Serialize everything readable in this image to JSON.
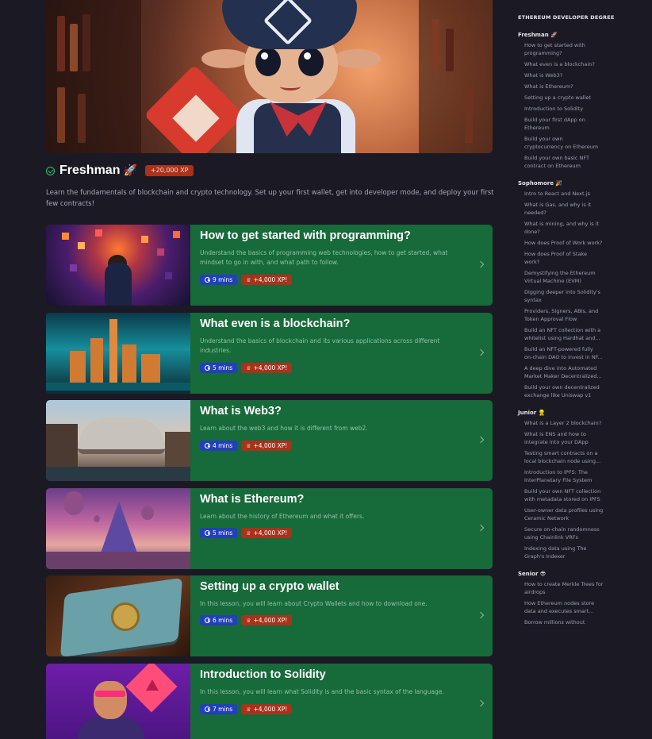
{
  "hero": {
    "alt": "Cartoon elf character in a pirate hat"
  },
  "header": {
    "title": "Freshman",
    "title_emoji": "🚀",
    "xp_badge": "+20,000 XP",
    "intro": "Learn the fundamentals of blockchain and crypto technology. Set up your first wallet, get into developer mode, and deploy your first few contracts!"
  },
  "lessons": [
    {
      "title": "How to get started with programming?",
      "description": "Understand the basics of programming web technologies, how to get started, what mindset to go in with, and what path to follow.",
      "time": "9 mins",
      "xp": "+4,000 XP!"
    },
    {
      "title": "What even is a blockchain?",
      "description": "Understand the basics of blockchain and its various applications across different industries.",
      "time": "5 mins",
      "xp": "+4,000 XP!"
    },
    {
      "title": "What is Web3?",
      "description": "Learn about the web3 and how it is different from web2.",
      "time": "4 mins",
      "xp": "+4,000 XP!"
    },
    {
      "title": "What is Ethereum?",
      "description": "Learn about the history of Ethereum and what it offers.",
      "time": "5 mins",
      "xp": "+4,000 XP!"
    },
    {
      "title": "Setting up a crypto wallet",
      "description": "In this lesson, you will learn about Crypto Wallets and how to download one.",
      "time": "6 mins",
      "xp": "+4,000 XP!"
    },
    {
      "title": "Introduction to Solidity",
      "description": "In this lesson, you will learn what Solidity is and the basic syntax of the language.",
      "time": "7 mins",
      "xp": "+4,000 XP!"
    }
  ],
  "sidebar": {
    "heading": "ETHEREUM DEVELOPER DEGREE",
    "sections": [
      {
        "label": "Freshman 🚀",
        "items": [
          [
            "How to get started with",
            "programming?"
          ],
          [
            "What even is a blockchain?"
          ],
          [
            "What is Web3?"
          ],
          [
            "What is Ethereum?"
          ],
          [
            "Setting up a crypto wallet"
          ],
          [
            "Introduction to Solidity"
          ],
          [
            "Build your first dApp on",
            "Ethereum"
          ],
          [
            "Build your own",
            "cryptocurrency on Ethereum"
          ],
          [
            "Build your own basic NFT",
            "contract on Ethereum"
          ]
        ]
      },
      {
        "label": "Sophomore 🎉",
        "items": [
          [
            "Intro to React and Next.js"
          ],
          [
            "What is Gas, and why is it",
            "needed?"
          ],
          [
            "What is mining, and why is it",
            "done?"
          ],
          [
            "How does Proof of Work work?"
          ],
          [
            "How does Proof of Stake",
            "work?"
          ],
          [
            "Demystifying the Ethereum",
            "Virtual Machine (EVM)"
          ],
          [
            "Digging deeper into Solidity's",
            "syntax"
          ],
          [
            "Providers, Signers, ABIs, and",
            "Token Approval Flow"
          ],
          [
            "Build an NFT collection with a",
            "whitelist using Hardhat and..."
          ],
          [
            "Build an NFT-powered fully",
            "on-chain DAO to invest in NF..."
          ],
          [
            "A deep dive into Automated",
            "Market Maker Decentralized..."
          ],
          [
            "Build your own decentralized",
            "exchange like Uniswap v1"
          ]
        ]
      },
      {
        "label": "Junior 👷",
        "items": [
          [
            "What is a Layer 2 blockchain?"
          ],
          [
            "What is ENS and how to",
            "integrate into your DApp"
          ],
          [
            "Testing smart contracts on a",
            "local blockchain node using..."
          ],
          [
            "Introduction to IPFS: The",
            "InterPlanetary File System"
          ],
          [
            "Build your own NFT collection",
            "with metadata stored on IPFS"
          ],
          [
            "User-owner data profiles using",
            "Ceramic Network"
          ],
          [
            "Secure on-chain randomness",
            "using Chainlink VRFs"
          ],
          [
            "Indexing data using The",
            "Graph's Indexer"
          ]
        ]
      },
      {
        "label": "Senior 😎",
        "items": [
          [
            "How to create Merkle Trees for",
            "airdrops"
          ],
          [
            "How Ethereum nodes store",
            "data and executes smart..."
          ],
          [
            "Borrow millions without"
          ]
        ]
      }
    ]
  },
  "colors": {
    "background": "#1b1a24",
    "card": "#176a3a",
    "xp": "#a8321a",
    "time": "#2240b8",
    "check": "#2fbf6b"
  }
}
